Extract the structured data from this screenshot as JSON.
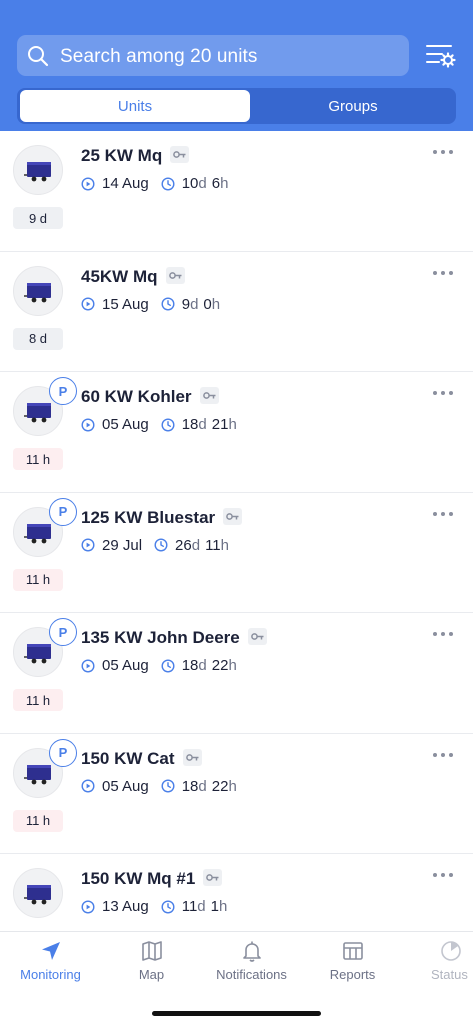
{
  "colors": {
    "accent": "#4a7fe8",
    "header_bg": "#4a7fe8",
    "warn_badge_bg": "#fdeef0",
    "text": "#1d2238"
  },
  "search": {
    "placeholder": "Search among 20 units",
    "icon": "search-icon"
  },
  "filter": {
    "icon": "filter-settings-icon"
  },
  "segments": {
    "active": "Units",
    "inactive": "Groups"
  },
  "units": [
    {
      "name": "25 KW Mq",
      "date": "14 Aug",
      "dur_d": "10",
      "dur_h": "6",
      "age": "9 d",
      "parked": false,
      "warn": false
    },
    {
      "name": "45KW Mq",
      "date": "15 Aug",
      "dur_d": "9",
      "dur_h": "0",
      "age": "8 d",
      "parked": false,
      "warn": false
    },
    {
      "name": "60 KW Kohler",
      "date": "05 Aug",
      "dur_d": "18",
      "dur_h": "21",
      "age": "11 h",
      "parked": true,
      "warn": true
    },
    {
      "name": "125 KW Bluestar",
      "date": "29 Jul",
      "dur_d": "26",
      "dur_h": "11",
      "age": "11 h",
      "parked": true,
      "warn": true
    },
    {
      "name": "135 KW John Deere",
      "date": "05 Aug",
      "dur_d": "18",
      "dur_h": "22",
      "age": "11 h",
      "parked": true,
      "warn": true
    },
    {
      "name": "150 KW Cat",
      "date": "05 Aug",
      "dur_d": "18",
      "dur_h": "22",
      "age": "11 h",
      "parked": true,
      "warn": true
    },
    {
      "name": "150 KW Mq #1",
      "date": "13 Aug",
      "dur_d": "11",
      "dur_h": "1",
      "age": "",
      "parked": false,
      "warn": false
    }
  ],
  "parked_badge": "P",
  "tabs": [
    {
      "label": "Monitoring",
      "icon": "navigation-arrow-icon",
      "active": true
    },
    {
      "label": "Map",
      "icon": "map-icon",
      "active": false
    },
    {
      "label": "Notifications",
      "icon": "bell-icon",
      "active": false
    },
    {
      "label": "Reports",
      "icon": "reports-icon",
      "active": false
    },
    {
      "label": "Status",
      "icon": "status-icon",
      "active": false
    }
  ]
}
